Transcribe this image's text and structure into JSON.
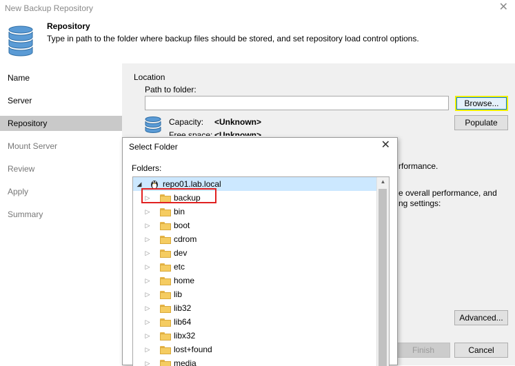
{
  "window": {
    "title": "New Backup Repository",
    "close_glyph": "✕"
  },
  "header": {
    "title": "Repository",
    "description": "Type in path to the folder where backup files should be stored, and set repository load control options.",
    "icon": "database-icon"
  },
  "sidebar": {
    "items": [
      {
        "label": "Name",
        "state": "normal"
      },
      {
        "label": "Server",
        "state": "normal"
      },
      {
        "label": "Repository",
        "state": "active"
      },
      {
        "label": "Mount Server",
        "state": "dim"
      },
      {
        "label": "Review",
        "state": "dim"
      },
      {
        "label": "Apply",
        "state": "dim"
      },
      {
        "label": "Summary",
        "state": "dim"
      }
    ]
  },
  "main": {
    "location_label": "Location",
    "path_label": "Path to folder:",
    "path_value": "",
    "browse_label": "Browse...",
    "populate_label": "Populate",
    "capacity_label": "Capacity:",
    "capacity_value": "<Unknown>",
    "free_space_label": "Free space:",
    "free_space_value": "<Unknown>",
    "load_text_1": "rformance.",
    "load_text_2": "e overall performance, and",
    "load_text_3": "ng settings:",
    "advanced_label": "Advanced...",
    "finish_label": "Finish",
    "cancel_label": "Cancel",
    "colors": {
      "accent_border": "#f0f000",
      "focus_blue": "#0078d7",
      "highlight_red": "#e02020"
    }
  },
  "dialog": {
    "title": "Select Folder",
    "close_glyph": "✕",
    "folders_label": "Folders:",
    "root": {
      "label": "repo01.lab.local",
      "icon": "linux-server-icon",
      "expanded": true
    },
    "folders": [
      {
        "label": "backup",
        "highlighted": true
      },
      {
        "label": "bin"
      },
      {
        "label": "boot"
      },
      {
        "label": "cdrom"
      },
      {
        "label": "dev"
      },
      {
        "label": "etc"
      },
      {
        "label": "home"
      },
      {
        "label": "lib"
      },
      {
        "label": "lib32"
      },
      {
        "label": "lib64"
      },
      {
        "label": "libx32"
      },
      {
        "label": "lost+found"
      },
      {
        "label": "media"
      }
    ]
  }
}
